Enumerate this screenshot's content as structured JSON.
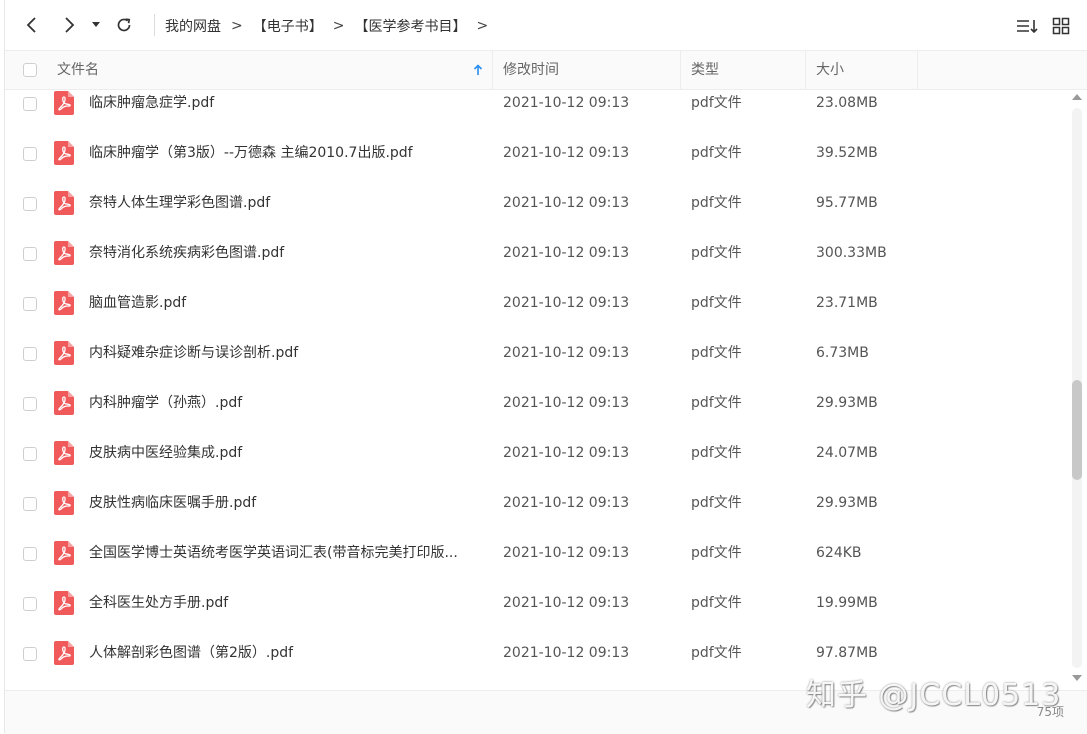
{
  "nav": {
    "back_icon": "chevron-left-icon",
    "forward_icon": "chevron-right-icon",
    "dropdown_icon": "caret-down-icon",
    "refresh_icon": "refresh-icon",
    "breadcrumbs": [
      "我的网盘",
      "【电子书】",
      "【医学参考书目】"
    ],
    "sort_icon": "sort-list-icon",
    "grid_icon": "grid-view-icon"
  },
  "columns": {
    "name": "文件名",
    "modified": "修改时间",
    "type": "类型",
    "size": "大小"
  },
  "files": [
    {
      "name": "临床肿瘤急症学.pdf",
      "modified": "2021-10-12 09:13",
      "type": "pdf文件",
      "size": "23.08MB"
    },
    {
      "name": "临床肿瘤学（第3版）--万德森 主编2010.7出版.pdf",
      "modified": "2021-10-12 09:13",
      "type": "pdf文件",
      "size": "39.52MB"
    },
    {
      "name": "奈特人体生理学彩色图谱.pdf",
      "modified": "2021-10-12 09:13",
      "type": "pdf文件",
      "size": "95.77MB"
    },
    {
      "name": "奈特消化系统疾病彩色图谱.pdf",
      "modified": "2021-10-12 09:13",
      "type": "pdf文件",
      "size": "300.33MB"
    },
    {
      "name": "脑血管造影.pdf",
      "modified": "2021-10-12 09:13",
      "type": "pdf文件",
      "size": "23.71MB"
    },
    {
      "name": "内科疑难杂症诊断与误诊剖析.pdf",
      "modified": "2021-10-12 09:13",
      "type": "pdf文件",
      "size": "6.73MB"
    },
    {
      "name": "内科肿瘤学（孙燕）.pdf",
      "modified": "2021-10-12 09:13",
      "type": "pdf文件",
      "size": "29.93MB"
    },
    {
      "name": "皮肤病中医经验集成.pdf",
      "modified": "2021-10-12 09:13",
      "type": "pdf文件",
      "size": "24.07MB"
    },
    {
      "name": "皮肤性病临床医嘱手册.pdf",
      "modified": "2021-10-12 09:13",
      "type": "pdf文件",
      "size": "29.93MB"
    },
    {
      "name": "全国医学博士英语统考医学英语词汇表(带音标完美打印版...",
      "modified": "2021-10-12 09:13",
      "type": "pdf文件",
      "size": "624KB"
    },
    {
      "name": "全科医生处方手册.pdf",
      "modified": "2021-10-12 09:13",
      "type": "pdf文件",
      "size": "19.99MB"
    },
    {
      "name": "人体解剖彩色图谱（第2版）.pdf",
      "modified": "2021-10-12 09:13",
      "type": "pdf文件",
      "size": "97.87MB"
    }
  ],
  "footer": {
    "count": "75项"
  },
  "watermark": "知乎 @JCCL0513",
  "colors": {
    "pdf_icon": "#f05a5a",
    "sort_arrow": "#2b8ff2"
  }
}
